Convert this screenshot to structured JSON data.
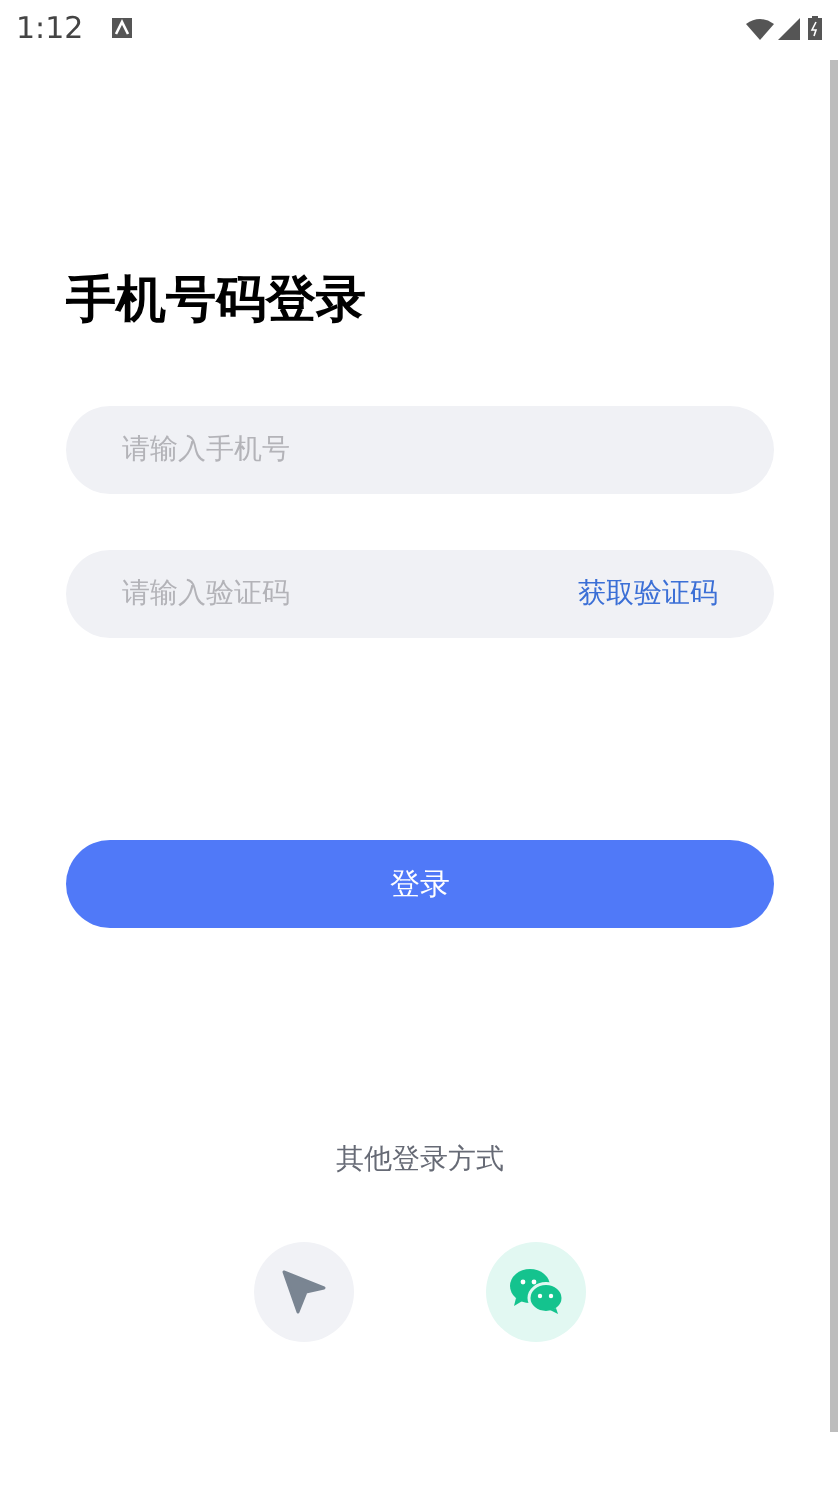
{
  "status_bar": {
    "time": "1:12"
  },
  "title": "手机号码登录",
  "phone_field": {
    "placeholder": "请输入手机号"
  },
  "code_field": {
    "placeholder": "请输入验证码"
  },
  "get_code_link": "获取验证码",
  "login_button": "登录",
  "other_login_label": "其他登录方式",
  "login_options": [
    {
      "kind": "location"
    },
    {
      "kind": "wechat"
    }
  ]
}
